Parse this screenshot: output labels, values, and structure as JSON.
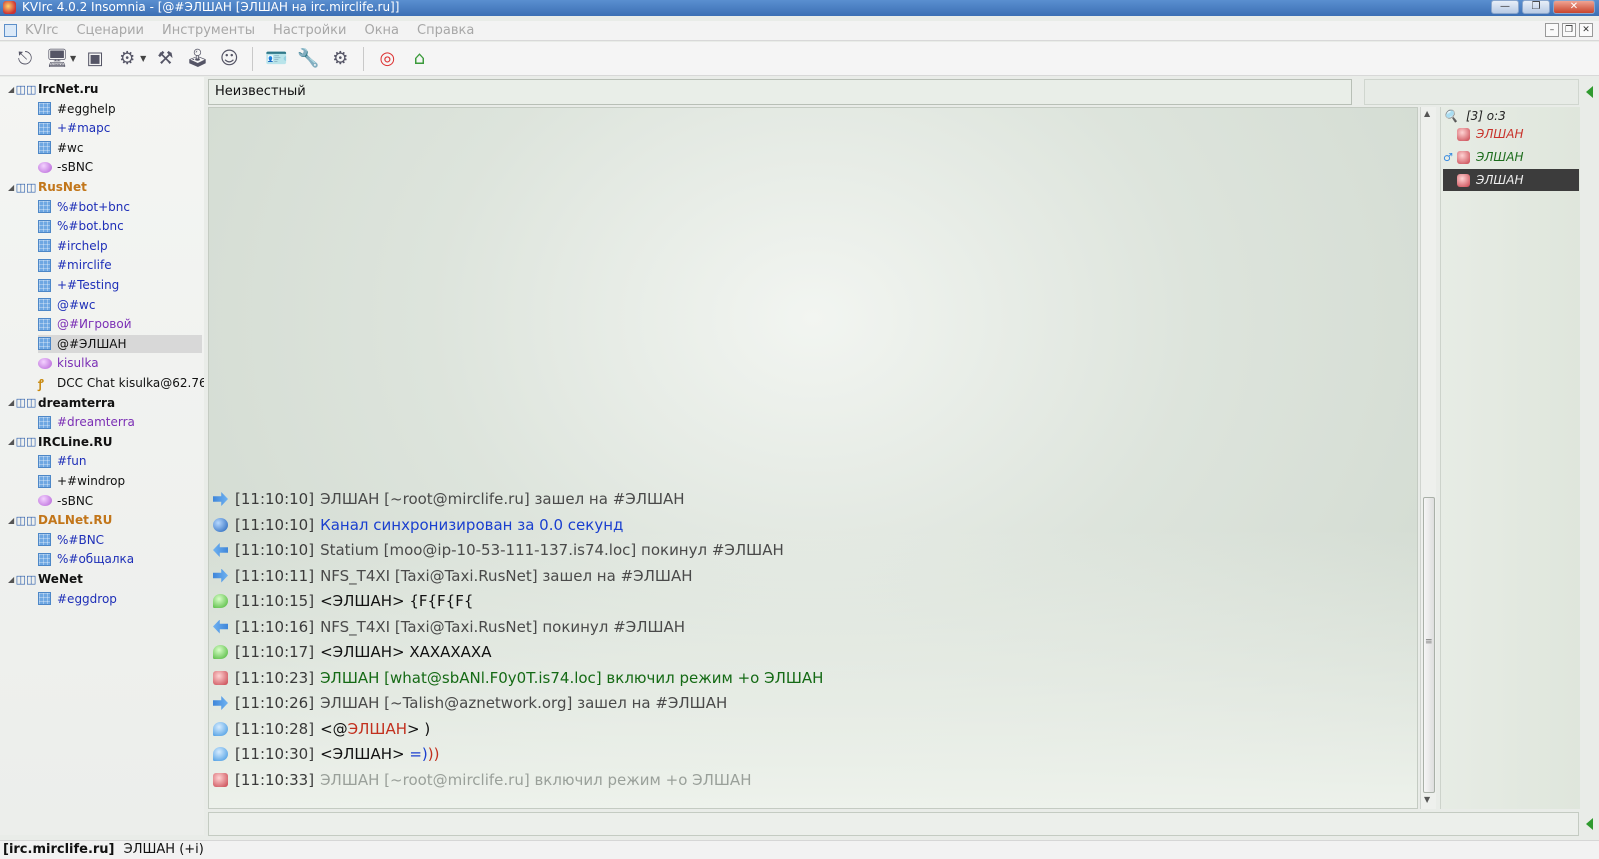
{
  "window": {
    "title": "KVIrc 4.0.2 Insomnia - [@#ЭЛШАН [ЭЛШАН на irc.mirclife.ru]]"
  },
  "menu": {
    "items": [
      "KVIrc",
      "Сценарии",
      "Инструменты",
      "Настройки",
      "Окна",
      "Справка"
    ]
  },
  "toolbar": {
    "buttons": [
      "connect-icon",
      "server-icon",
      "new-window-icon",
      "join-icon",
      "tools-icon",
      "joystick-icon",
      "user-icon",
      "identity-icon",
      "wrench-icon",
      "options-icon",
      "help-icon",
      "home-icon"
    ]
  },
  "tree": {
    "networks": [
      {
        "name": "IrcNet.ru",
        "color": "#111111",
        "items": [
          {
            "label": "#egghelp",
            "type": "channel",
            "color": "#111111"
          },
          {
            "label": "+#mapc",
            "type": "channel",
            "color": "#1e2fb8"
          },
          {
            "label": "#wc",
            "type": "channel",
            "color": "#111111"
          },
          {
            "label": "-sBNC",
            "type": "query",
            "color": "#111111"
          }
        ]
      },
      {
        "name": "RusNet",
        "color": "#c2761a",
        "items": [
          {
            "label": "%#bot+bnc",
            "type": "channel",
            "color": "#1e2fb8"
          },
          {
            "label": "%#bot.bnc",
            "type": "channel",
            "color": "#1e2fb8"
          },
          {
            "label": "#irchelp",
            "type": "channel",
            "color": "#1e2fb8"
          },
          {
            "label": "#mirclife",
            "type": "channel",
            "color": "#1e2fb8"
          },
          {
            "label": "+#Testing",
            "type": "channel",
            "color": "#1e2fb8"
          },
          {
            "label": "@#wc",
            "type": "channel",
            "color": "#1e2fb8"
          },
          {
            "label": "@#Игровой",
            "type": "channel",
            "color": "#7b2fb5"
          },
          {
            "label": "@#ЭЛШАН",
            "type": "channel",
            "color": "#111111",
            "selected": true
          },
          {
            "label": "kisulka",
            "type": "query",
            "color": "#7b2fb5"
          },
          {
            "label": "DCC Chat kisulka@62.76.",
            "type": "dcc",
            "color": "#111111"
          }
        ]
      },
      {
        "name": "dreamterra",
        "color": "#111111",
        "items": [
          {
            "label": "#dreamterra",
            "type": "channel",
            "color": "#7b2fb5"
          }
        ]
      },
      {
        "name": "IRCLine.RU",
        "color": "#111111",
        "items": [
          {
            "label": "#fun",
            "type": "channel",
            "color": "#1e2fb8"
          },
          {
            "label": "+#windrop",
            "type": "channel",
            "color": "#111111"
          },
          {
            "label": "-sBNC",
            "type": "query",
            "color": "#111111"
          }
        ]
      },
      {
        "name": "DALNet.RU",
        "color": "#c2761a",
        "items": [
          {
            "label": "%#BNC",
            "type": "channel",
            "color": "#1e2fb8"
          },
          {
            "label": "%#общалка",
            "type": "channel",
            "color": "#1e2fb8"
          }
        ]
      },
      {
        "name": "WeNet",
        "color": "#111111",
        "items": [
          {
            "label": "#eggdrop",
            "type": "channel",
            "color": "#1e2fb8"
          }
        ]
      }
    ]
  },
  "topic": {
    "text": "Неизвестный"
  },
  "output": {
    "lines": [
      {
        "icon": "join",
        "ts": "[11:10:10]",
        "parts": [
          {
            "t": "ЭЛШАН [~root@mirclife.ru] зашел на #ЭЛШАН",
            "c": "gray"
          }
        ]
      },
      {
        "icon": "sync",
        "ts": "[11:10:10]",
        "parts": [
          {
            "t": "Канал синхронизирован за 0.0 секунд",
            "c": "blue"
          }
        ]
      },
      {
        "icon": "part",
        "ts": "[11:10:10]",
        "parts": [
          {
            "t": "Statium [moo@ip-10-53-111-137.is74.loc] покинул #ЭЛШАН",
            "c": "gray"
          }
        ]
      },
      {
        "icon": "join",
        "ts": "[11:10:11]",
        "parts": [
          {
            "t": "NFS_T4XI [Taxi@Taxi.RusNet] зашел на #ЭЛШАН",
            "c": "gray"
          }
        ]
      },
      {
        "icon": "msg-green",
        "ts": "[11:10:15]",
        "parts": [
          {
            "t": "<ЭЛШАН> {F{F{F{",
            "c": "black"
          }
        ]
      },
      {
        "icon": "part",
        "ts": "[11:10:16]",
        "parts": [
          {
            "t": "NFS_T4XI [Taxi@Taxi.RusNet] покинул #ЭЛШАН",
            "c": "gray"
          }
        ]
      },
      {
        "icon": "msg-green",
        "ts": "[11:10:17]",
        "parts": [
          {
            "t": "<ЭЛШАН> ХАХАХАХА",
            "c": "black"
          }
        ]
      },
      {
        "icon": "op",
        "ts": "[11:10:23]",
        "parts": [
          {
            "t": "ЭЛШАН [what@sbANl.F0y0T.is74.loc] включил режим +o ЭЛШАН",
            "c": "green"
          }
        ]
      },
      {
        "icon": "join",
        "ts": "[11:10:26]",
        "parts": [
          {
            "t": "ЭЛШАН [~Talish@aznetwork.org] зашел на #ЭЛШАН",
            "c": "gray"
          }
        ]
      },
      {
        "icon": "msg-blue",
        "ts": "[11:10:28]",
        "parts": [
          {
            "t": "<@",
            "c": "black"
          },
          {
            "t": "ЭЛШАН",
            "c": "red"
          },
          {
            "t": "> )",
            "c": "black"
          }
        ]
      },
      {
        "icon": "msg-blue",
        "ts": "[11:10:30]",
        "parts": [
          {
            "t": "<ЭЛШАН> ",
            "c": "black"
          },
          {
            "t": "=)",
            "c": "blue"
          },
          {
            "t": "))",
            "c": "red"
          }
        ]
      },
      {
        "icon": "op",
        "ts": "[11:10:33]",
        "parts": [
          {
            "t": "ЭЛШАН [~root@mirclife.ru] включил режим +o ЭЛШАН",
            "c": "faded"
          }
        ]
      }
    ]
  },
  "userlist": {
    "header": "[3] o:3",
    "users": [
      {
        "name": "ЭЛШАН",
        "style": "red",
        "flag": ""
      },
      {
        "name": "ЭЛШАН",
        "style": "green",
        "flag": "♂"
      },
      {
        "name": "ЭЛШАН",
        "style": "selected",
        "flag": ""
      }
    ]
  },
  "status": {
    "server": "[irc.mirclife.ru]",
    "nick": "ЭЛШАН (+i)"
  }
}
